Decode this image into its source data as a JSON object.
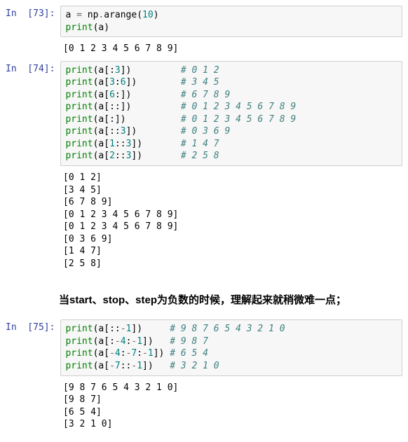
{
  "cells": [
    {
      "prompt": "In  [73]:",
      "type": "in",
      "code_lines": [
        {
          "segments": [
            {
              "t": "a",
              "c": "tok-var"
            },
            {
              "t": " = ",
              "c": "tok-op"
            },
            {
              "t": "np",
              "c": "tok-var"
            },
            {
              "t": ".",
              "c": "tok-op"
            },
            {
              "t": "arange",
              "c": "tok-var"
            },
            {
              "t": "(",
              "c": "tok-paren"
            },
            {
              "t": "10",
              "c": "tok-num"
            },
            {
              "t": ")",
              "c": "tok-paren"
            }
          ]
        },
        {
          "segments": [
            {
              "t": "print",
              "c": "tok-func"
            },
            {
              "t": "(",
              "c": "tok-paren"
            },
            {
              "t": "a",
              "c": "tok-var"
            },
            {
              "t": ")",
              "c": "tok-paren"
            }
          ]
        }
      ]
    },
    {
      "type": "out",
      "output_lines": [
        "[0 1 2 3 4 5 6 7 8 9]"
      ]
    },
    {
      "prompt": "In  [74]:",
      "type": "in",
      "code_lines": [
        {
          "segments": [
            {
              "t": "print",
              "c": "tok-func"
            },
            {
              "t": "(",
              "c": "tok-paren"
            },
            {
              "t": "a",
              "c": "tok-var"
            },
            {
              "t": "[:",
              "c": "tok-paren"
            },
            {
              "t": "3",
              "c": "tok-num"
            },
            {
              "t": "])",
              "c": "tok-paren"
            },
            {
              "t": "         ",
              "c": ""
            },
            {
              "t": "# 0 1 2",
              "c": "tok-comment"
            }
          ]
        },
        {
          "segments": [
            {
              "t": "print",
              "c": "tok-func"
            },
            {
              "t": "(",
              "c": "tok-paren"
            },
            {
              "t": "a",
              "c": "tok-var"
            },
            {
              "t": "[",
              "c": "tok-paren"
            },
            {
              "t": "3",
              "c": "tok-num"
            },
            {
              "t": ":",
              "c": "tok-paren"
            },
            {
              "t": "6",
              "c": "tok-num"
            },
            {
              "t": "])",
              "c": "tok-paren"
            },
            {
              "t": "        ",
              "c": ""
            },
            {
              "t": "# 3 4 5",
              "c": "tok-comment"
            }
          ]
        },
        {
          "segments": [
            {
              "t": "print",
              "c": "tok-func"
            },
            {
              "t": "(",
              "c": "tok-paren"
            },
            {
              "t": "a",
              "c": "tok-var"
            },
            {
              "t": "[",
              "c": "tok-paren"
            },
            {
              "t": "6",
              "c": "tok-num"
            },
            {
              "t": ":])",
              "c": "tok-paren"
            },
            {
              "t": "         ",
              "c": ""
            },
            {
              "t": "# 6 7 8 9",
              "c": "tok-comment"
            }
          ]
        },
        {
          "segments": [
            {
              "t": "print",
              "c": "tok-func"
            },
            {
              "t": "(",
              "c": "tok-paren"
            },
            {
              "t": "a",
              "c": "tok-var"
            },
            {
              "t": "[::])",
              "c": "tok-paren"
            },
            {
              "t": "         ",
              "c": ""
            },
            {
              "t": "# 0 1 2 3 4 5 6 7 8 9",
              "c": "tok-comment"
            }
          ]
        },
        {
          "segments": [
            {
              "t": "print",
              "c": "tok-func"
            },
            {
              "t": "(",
              "c": "tok-paren"
            },
            {
              "t": "a",
              "c": "tok-var"
            },
            {
              "t": "[:])",
              "c": "tok-paren"
            },
            {
              "t": "          ",
              "c": ""
            },
            {
              "t": "# 0 1 2 3 4 5 6 7 8 9",
              "c": "tok-comment"
            }
          ]
        },
        {
          "segments": [
            {
              "t": "print",
              "c": "tok-func"
            },
            {
              "t": "(",
              "c": "tok-paren"
            },
            {
              "t": "a",
              "c": "tok-var"
            },
            {
              "t": "[::",
              "c": "tok-paren"
            },
            {
              "t": "3",
              "c": "tok-num"
            },
            {
              "t": "])",
              "c": "tok-paren"
            },
            {
              "t": "        ",
              "c": ""
            },
            {
              "t": "# 0 3 6 9",
              "c": "tok-comment"
            }
          ]
        },
        {
          "segments": [
            {
              "t": "print",
              "c": "tok-func"
            },
            {
              "t": "(",
              "c": "tok-paren"
            },
            {
              "t": "a",
              "c": "tok-var"
            },
            {
              "t": "[",
              "c": "tok-paren"
            },
            {
              "t": "1",
              "c": "tok-num"
            },
            {
              "t": "::",
              "c": "tok-paren"
            },
            {
              "t": "3",
              "c": "tok-num"
            },
            {
              "t": "])",
              "c": "tok-paren"
            },
            {
              "t": "       ",
              "c": ""
            },
            {
              "t": "# 1 4 7",
              "c": "tok-comment"
            }
          ]
        },
        {
          "segments": [
            {
              "t": "print",
              "c": "tok-func"
            },
            {
              "t": "(",
              "c": "tok-paren"
            },
            {
              "t": "a",
              "c": "tok-var"
            },
            {
              "t": "[",
              "c": "tok-paren"
            },
            {
              "t": "2",
              "c": "tok-num"
            },
            {
              "t": "::",
              "c": "tok-paren"
            },
            {
              "t": "3",
              "c": "tok-num"
            },
            {
              "t": "])",
              "c": "tok-paren"
            },
            {
              "t": "       ",
              "c": ""
            },
            {
              "t": "# 2 5 8",
              "c": "tok-comment"
            }
          ]
        }
      ]
    },
    {
      "type": "out",
      "output_lines": [
        "[0 1 2]",
        "[3 4 5]",
        "[6 7 8 9]",
        "[0 1 2 3 4 5 6 7 8 9]",
        "[0 1 2 3 4 5 6 7 8 9]",
        "[0 3 6 9]",
        "[1 4 7]",
        "[2 5 8]"
      ]
    }
  ],
  "heading": "当start、stop、step为负数的时候，理解起来就稍微难一点；",
  "cells2": [
    {
      "prompt": "In  [75]:",
      "type": "in",
      "code_lines": [
        {
          "segments": [
            {
              "t": "print",
              "c": "tok-func"
            },
            {
              "t": "(",
              "c": "tok-paren"
            },
            {
              "t": "a",
              "c": "tok-var"
            },
            {
              "t": "[::",
              "c": "tok-paren"
            },
            {
              "t": "-",
              "c": "tok-op"
            },
            {
              "t": "1",
              "c": "tok-num"
            },
            {
              "t": "])",
              "c": "tok-paren"
            },
            {
              "t": "     ",
              "c": ""
            },
            {
              "t": "# 9 8 7 6 5 4 3 2 1 0",
              "c": "tok-comment"
            }
          ]
        },
        {
          "segments": [
            {
              "t": "print",
              "c": "tok-func"
            },
            {
              "t": "(",
              "c": "tok-paren"
            },
            {
              "t": "a",
              "c": "tok-var"
            },
            {
              "t": "[:",
              "c": "tok-paren"
            },
            {
              "t": "-",
              "c": "tok-op"
            },
            {
              "t": "4",
              "c": "tok-num"
            },
            {
              "t": ":",
              "c": "tok-paren"
            },
            {
              "t": "-",
              "c": "tok-op"
            },
            {
              "t": "1",
              "c": "tok-num"
            },
            {
              "t": "])",
              "c": "tok-paren"
            },
            {
              "t": "   ",
              "c": ""
            },
            {
              "t": "# 9 8 7",
              "c": "tok-comment"
            }
          ]
        },
        {
          "segments": [
            {
              "t": "print",
              "c": "tok-func"
            },
            {
              "t": "(",
              "c": "tok-paren"
            },
            {
              "t": "a",
              "c": "tok-var"
            },
            {
              "t": "[",
              "c": "tok-paren"
            },
            {
              "t": "-",
              "c": "tok-op"
            },
            {
              "t": "4",
              "c": "tok-num"
            },
            {
              "t": ":",
              "c": "tok-paren"
            },
            {
              "t": "-",
              "c": "tok-op"
            },
            {
              "t": "7",
              "c": "tok-num"
            },
            {
              "t": ":",
              "c": "tok-paren"
            },
            {
              "t": "-",
              "c": "tok-op"
            },
            {
              "t": "1",
              "c": "tok-num"
            },
            {
              "t": "])",
              "c": "tok-paren"
            },
            {
              "t": " ",
              "c": ""
            },
            {
              "t": "# 6 5 4",
              "c": "tok-comment"
            }
          ]
        },
        {
          "segments": [
            {
              "t": "print",
              "c": "tok-func"
            },
            {
              "t": "(",
              "c": "tok-paren"
            },
            {
              "t": "a",
              "c": "tok-var"
            },
            {
              "t": "[",
              "c": "tok-paren"
            },
            {
              "t": "-",
              "c": "tok-op"
            },
            {
              "t": "7",
              "c": "tok-num"
            },
            {
              "t": "::",
              "c": "tok-paren"
            },
            {
              "t": "-",
              "c": "tok-op"
            },
            {
              "t": "1",
              "c": "tok-num"
            },
            {
              "t": "])",
              "c": "tok-paren"
            },
            {
              "t": "   ",
              "c": ""
            },
            {
              "t": "# 3 2 1 0",
              "c": "tok-comment"
            }
          ]
        }
      ]
    },
    {
      "type": "out",
      "output_lines": [
        "[9 8 7 6 5 4 3 2 1 0]",
        "[9 8 7]",
        "[6 5 4]",
        "[3 2 1 0]"
      ]
    }
  ]
}
